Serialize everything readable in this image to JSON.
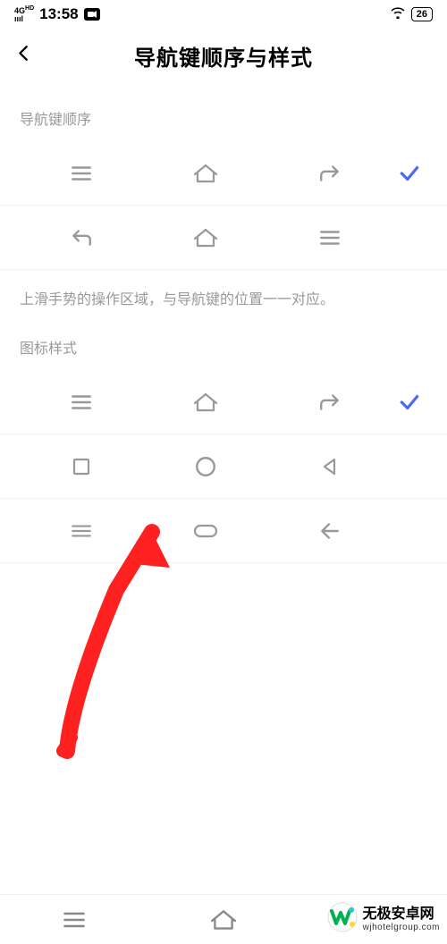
{
  "status": {
    "network": "4G HD",
    "time": "13:58",
    "battery": "26"
  },
  "header": {
    "title": "导航键顺序与样式"
  },
  "sections": {
    "order_label": "导航键顺序",
    "helper": "上滑手势的操作区域，与导航键的位置一一对应。",
    "style_label": "图标样式"
  },
  "watermark": {
    "title": "无极安卓网",
    "url": "wjhotelgroup.com"
  },
  "icons": {
    "menu": "menu-icon",
    "home": "home-icon",
    "back": "back-icon",
    "square": "square-icon",
    "circle": "circle-icon",
    "triangle": "triangle-icon",
    "pill": "pill-icon",
    "arrow_left": "arrow-left-icon",
    "check": "check-icon"
  }
}
